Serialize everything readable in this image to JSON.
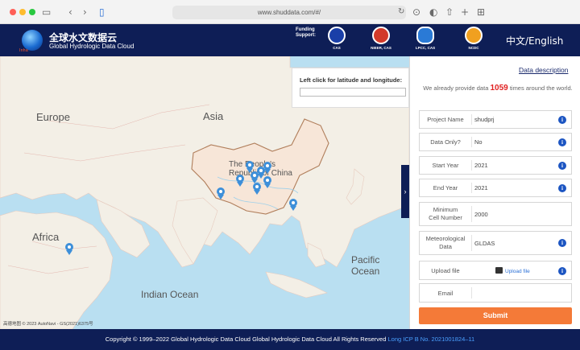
{
  "browser": {
    "url": "www.shuddata.com/#/",
    "colors": {
      "close": "#ff5f57",
      "minimize": "#febc2e",
      "maximize": "#28c840"
    }
  },
  "header": {
    "logo_text": "Inha",
    "title_cn": "全球水文数据云",
    "title_en": "Global Hydrologic Data Cloud",
    "funding_line1": "Funding",
    "funding_line2": "Support:",
    "sponsors": [
      {
        "label": "CAS",
        "color": "#1a3fa8"
      },
      {
        "label": "NIEER, CAS",
        "color": "#d23a2a"
      },
      {
        "label": "LPCC, CAS",
        "color": "#2a7ad6"
      },
      {
        "label": "NCDC",
        "color": "#f0a020"
      }
    ],
    "language": "中文/English"
  },
  "map": {
    "labels": {
      "europe": "Europe",
      "asia": "Asia",
      "china": "The People's Republic of China",
      "africa": "Africa",
      "indian_ocean": "Indian Ocean",
      "pacific_ocean": "Pacific Ocean"
    },
    "coord_prompt": "Left click for latitude and longitude:",
    "coord_value": "",
    "attribution": "高德地图 © 2023 AutoNavi - GS(2021)6375号",
    "pin_color": "#3d8fd9"
  },
  "form": {
    "data_description": "Data description",
    "provide_prefix": "We already provide data",
    "provide_count": "1059",
    "provide_suffix": "times around the world.",
    "fields": {
      "project_name": {
        "label": "Project Name",
        "value": "shudprj"
      },
      "data_only": {
        "label": "Data Only?",
        "value": "No"
      },
      "start_year": {
        "label": "Start Year",
        "value": "2021"
      },
      "end_year": {
        "label": "End Year",
        "value": "2021"
      },
      "min_cell": {
        "label": "Minimum Cell Number",
        "value": "2000"
      },
      "meteo": {
        "label": "Meteorological Data",
        "value": "GLDAS"
      },
      "upload": {
        "label": "Upload file",
        "button": "Upload file"
      },
      "email": {
        "label": "Email",
        "value": ""
      }
    },
    "info_glyph": "i",
    "submit": "Submit"
  },
  "footer": {
    "copyright": "Copyright © 1999–2022 Global Hydrologic Data Cloud Global Hydrologic Data Cloud All Rights Reserved",
    "icp": "Long ICP B No. 2021001824–11"
  }
}
